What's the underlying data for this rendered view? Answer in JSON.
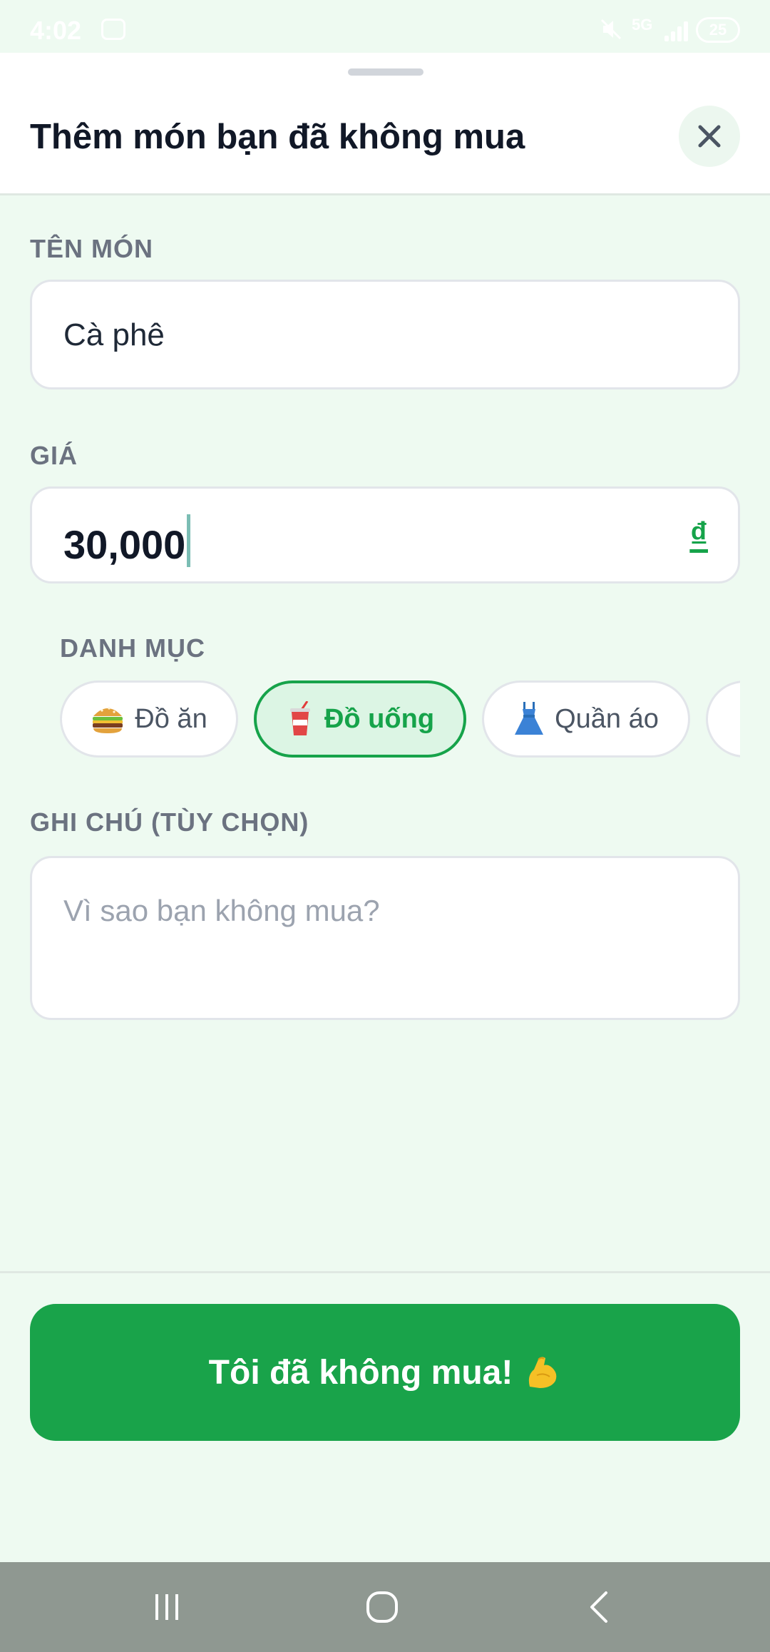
{
  "status_bar": {
    "time": "4:02",
    "network": "5G",
    "battery": "25"
  },
  "sheet": {
    "title": "Thêm món bạn đã không mua"
  },
  "form": {
    "name_label": "TÊN MÓN",
    "name_value": "Cà phê",
    "price_label": "GIÁ",
    "price_value": "30,000",
    "currency_symbol": "₫",
    "category_label": "DANH MỤC",
    "categories": [
      {
        "label": "Đồ ăn",
        "icon": "hamburger-icon",
        "selected": false
      },
      {
        "label": "Đồ uống",
        "icon": "cup-with-straw-icon",
        "selected": true
      },
      {
        "label": "Quần áo",
        "icon": "dress-icon",
        "selected": false
      }
    ],
    "note_label": "GHI CHÚ (TÙY CHỌN)",
    "note_placeholder": "Vì sao bạn không mua?"
  },
  "submit": {
    "label": "Tôi đã không mua!",
    "icon": "flexed-biceps-icon"
  },
  "colors": {
    "primary": "#19a34a",
    "background": "#eefaf1",
    "selected_chip_bg": "#dcf5e4"
  }
}
